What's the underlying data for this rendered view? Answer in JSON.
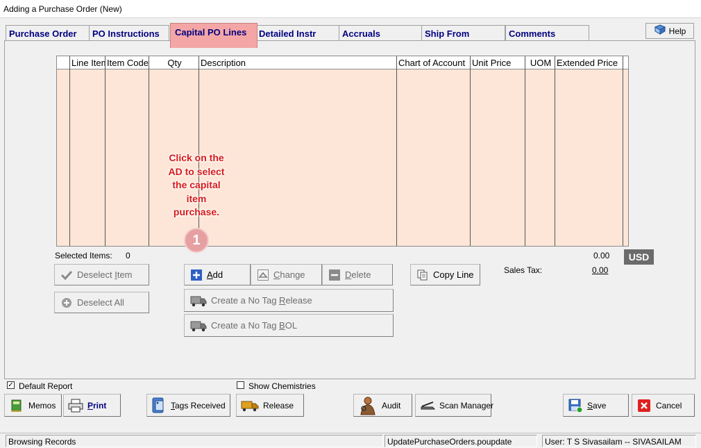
{
  "window": {
    "title": "Adding a Purchase Order  (New)"
  },
  "tabs": [
    {
      "label": "Purchase Order"
    },
    {
      "label": "PO Instructions"
    },
    {
      "label": "Capital PO Lines",
      "active": true
    },
    {
      "label": "Detailed Instr"
    },
    {
      "label": "Accruals"
    },
    {
      "label": "Ship From"
    },
    {
      "label": "Comments"
    }
  ],
  "help": {
    "label": "Help"
  },
  "grid": {
    "columns": [
      "Line Item",
      "Item Code",
      "Qty",
      "Description",
      "Chart of Account",
      "Unit Price",
      "UOM",
      "Extended Price"
    ]
  },
  "callout": {
    "lines": [
      "Click on the",
      "AD to select",
      "the capital",
      "item",
      "purchase."
    ],
    "step": "1"
  },
  "selection": {
    "label": "Selected Items:",
    "count": "0"
  },
  "totals": {
    "amount": "0.00",
    "currency": "USD",
    "sales_tax_label": "Sales Tax:",
    "sales_tax": "0.00"
  },
  "actions": {
    "deselect_item": {
      "pre": "Deselect ",
      "key": "I",
      "post": "tem"
    },
    "deselect_all": "Deselect All",
    "add": {
      "pre": "",
      "key": "A",
      "post": "dd"
    },
    "change": {
      "pre": "",
      "key": "C",
      "post": "hange"
    },
    "delete": {
      "pre": "",
      "key": "D",
      "post": "elete"
    },
    "copy_line": "Copy Line",
    "no_tag_release": {
      "pre": "Create a No Tag ",
      "key": "R",
      "post": "elease"
    },
    "no_tag_bol": {
      "pre": "Create a No Tag ",
      "key": "B",
      "post": "OL"
    }
  },
  "options": {
    "default_report": {
      "label": "Default Report",
      "checked": true
    },
    "show_chemistries": {
      "label": "Show Chemistries",
      "checked": false
    }
  },
  "bottom_buttons": {
    "memos": "Memos",
    "print": {
      "pre": "",
      "key": "P",
      "post": "rint"
    },
    "tags_received": {
      "pre": "",
      "key": "T",
      "post": "ags Received"
    },
    "release": "Release",
    "audit": "Audit",
    "scan_manager": "Scan Manager",
    "save": {
      "pre": "",
      "key": "S",
      "post": "ave"
    },
    "cancel": "Cancel"
  },
  "status": {
    "mode": "Browsing Records",
    "procedure": "UpdatePurchaseOrders.poupdate",
    "user": "User: T S Sivasailam -- SIVASAILAM"
  },
  "colors": {
    "active_tab": "#f4a6a6",
    "grid_bg": "#fde6d8",
    "callout": "#d61a1a",
    "tab_text": "#000080"
  }
}
